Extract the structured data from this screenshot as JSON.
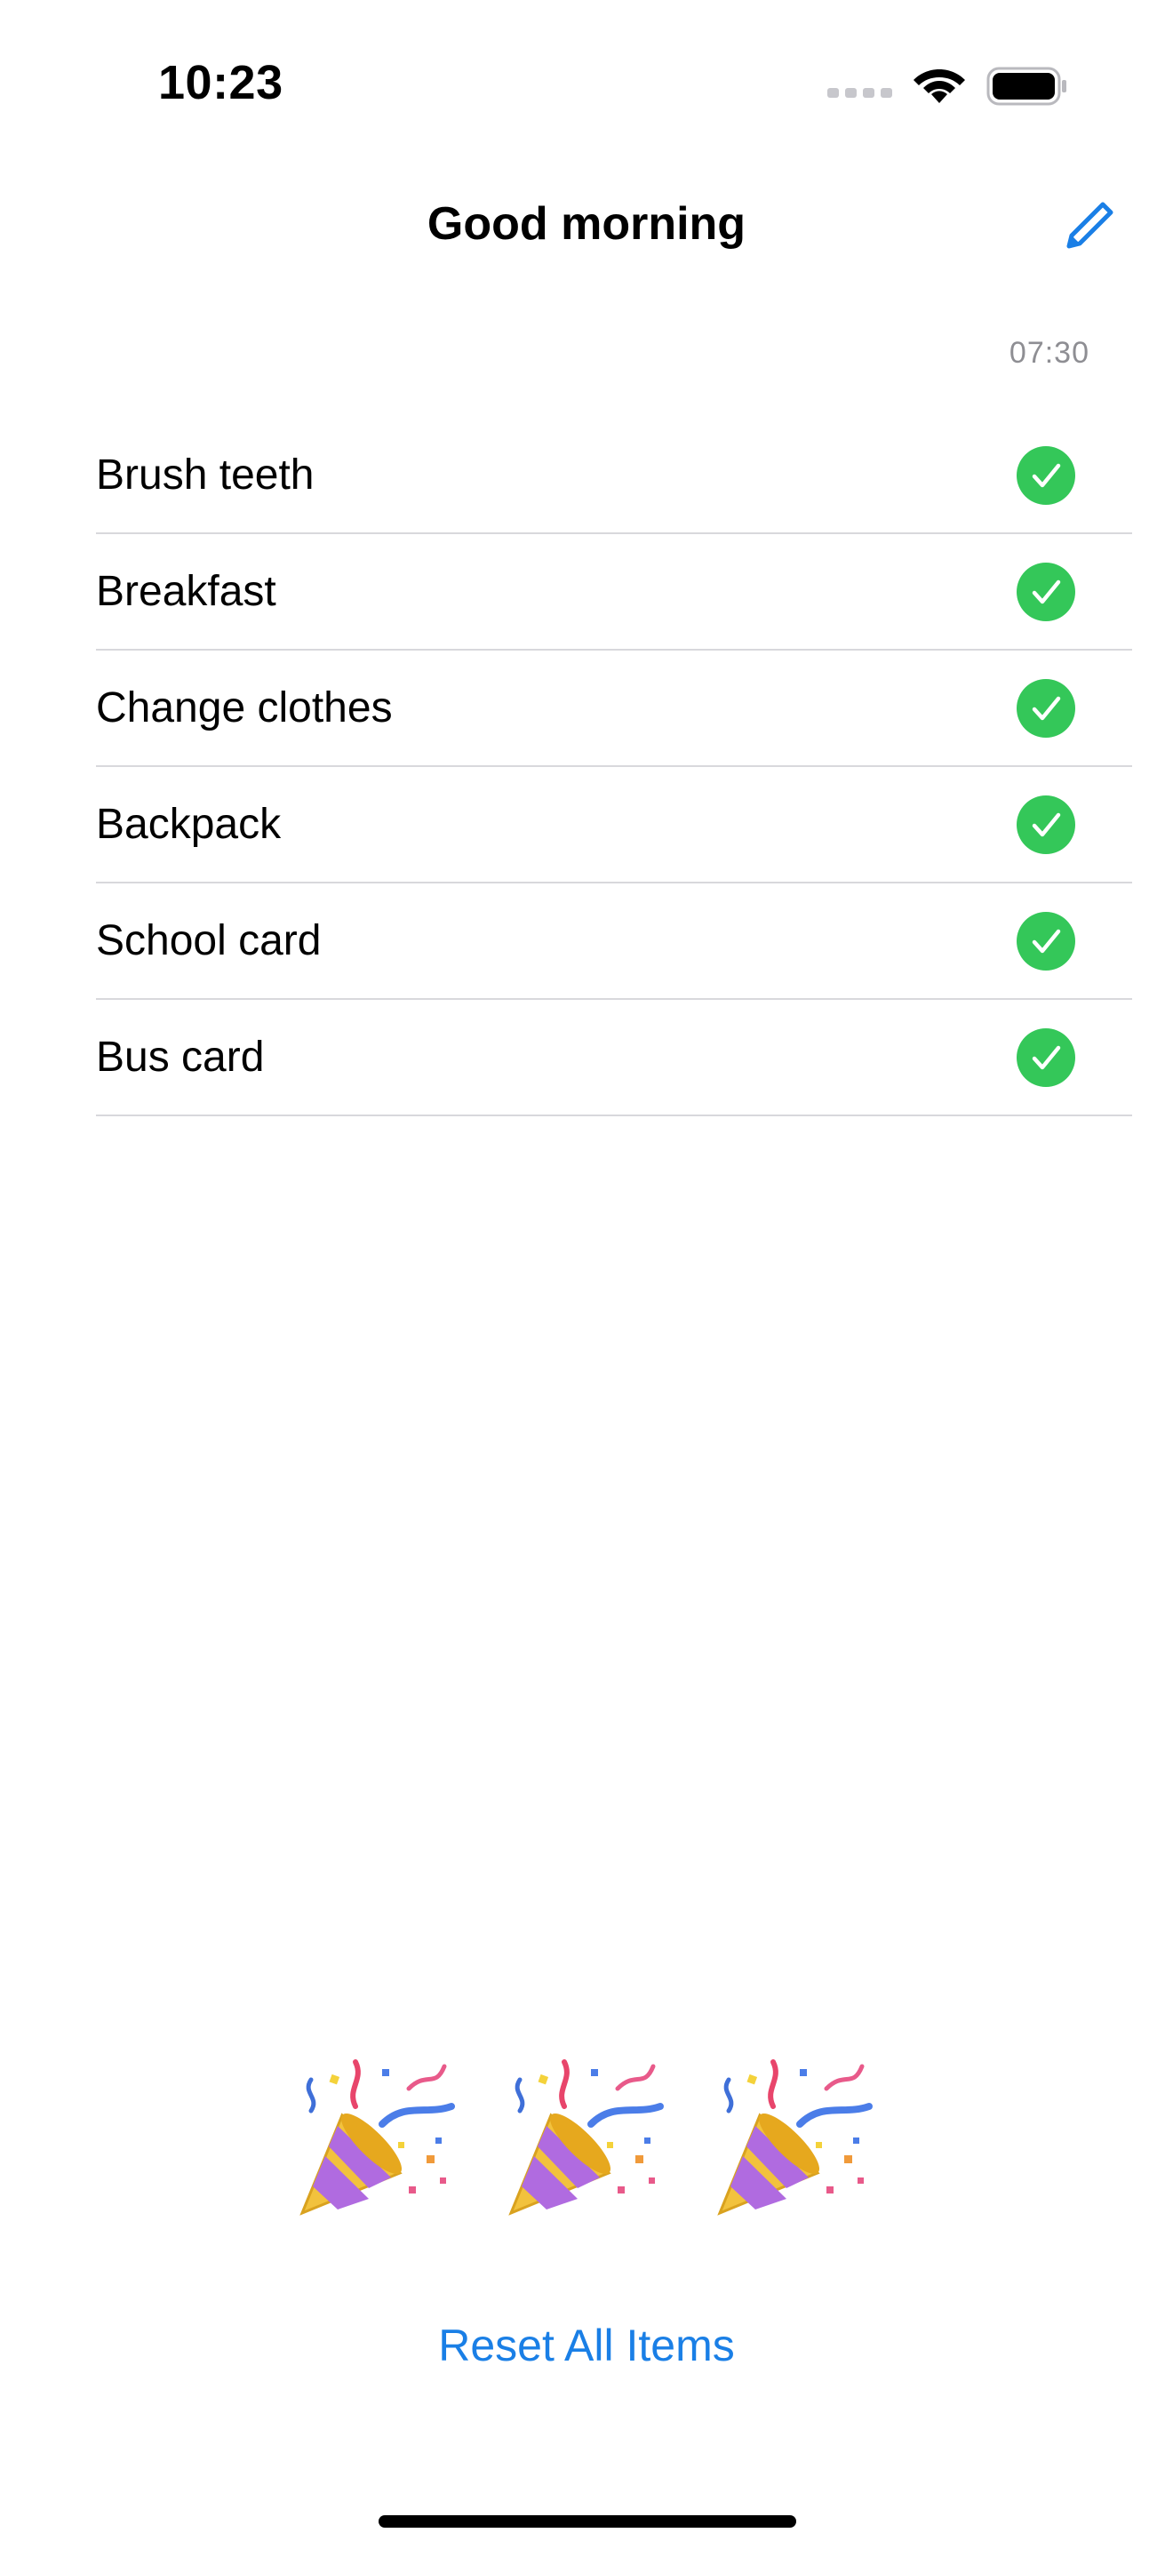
{
  "status_bar": {
    "time": "10:23"
  },
  "nav": {
    "title": "Good morning",
    "edit_icon": "pencil-icon"
  },
  "routine": {
    "time": "07:30"
  },
  "items": [
    {
      "label": "Brush teeth",
      "checked": true
    },
    {
      "label": "Breakfast",
      "checked": true
    },
    {
      "label": "Change clothes",
      "checked": true
    },
    {
      "label": "Backpack",
      "checked": true
    },
    {
      "label": "School card",
      "checked": true
    },
    {
      "label": "Bus card",
      "checked": true
    }
  ],
  "celebration": {
    "icon": "party-popper-icon",
    "count": 3
  },
  "actions": {
    "reset_label": "Reset All Items"
  },
  "colors": {
    "accent": "#1a7fe6",
    "check_green": "#34c759",
    "secondary_text": "#8e8e93",
    "separator": "#d8d8dc"
  }
}
